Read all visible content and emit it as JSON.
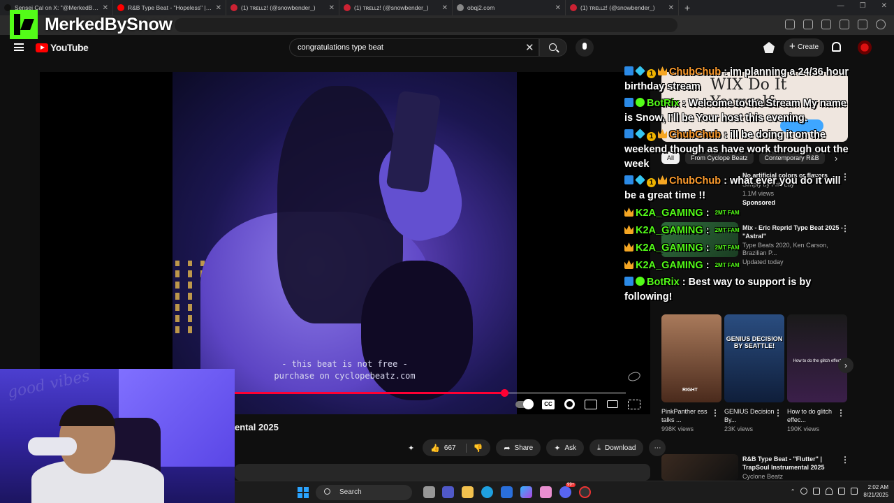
{
  "browser": {
    "tabs": [
      {
        "label": "Sensei Cal on X: \"@MerkedBySnow",
        "color": "#111111"
      },
      {
        "label": "R&B Type Beat - \"Hopeless\" | Trap",
        "color": "#ff0000"
      },
      {
        "label": "(1) ᴛʀᴇʟʟᴢ! (@snowbender_)",
        "color": "#cc2233"
      },
      {
        "label": "(1) ᴛʀᴇʟʟᴢ! (@snowbender_)",
        "color": "#cc2233"
      },
      {
        "label": "obqj2.com",
        "color": "#888888"
      },
      {
        "label": "(1) ᴛʀᴇʟʟᴢ! (@snowbender_)",
        "color": "#cc2233"
      }
    ],
    "new_tab": "+",
    "window_controls": [
      "—",
      "❐",
      "✕"
    ]
  },
  "overlay": {
    "brand_name": "MerkedBySnow"
  },
  "youtube": {
    "logo_text": "YouTube",
    "search_value": "congratulations type beat",
    "create_label": "Create"
  },
  "video": {
    "beat_text_line1": "- this beat is not free -",
    "beat_text_line2": "purchase on cyclopebeatz.com",
    "progress_fraction": 0.69,
    "title_fragment": "ental 2025",
    "actions": {
      "likes": "667",
      "share": "Share",
      "ask": "Ask",
      "download": "Download"
    }
  },
  "chat": [
    {
      "badges": [
        "blue",
        "cube",
        "one",
        "crown"
      ],
      "user": "ChubChub",
      "color": "orange",
      "text": "im planning a 24/36 hour birthday stream"
    },
    {
      "badges": [
        "blue",
        "check"
      ],
      "user": "BotRix",
      "color": "green",
      "text": "Welcome to the Stream My name is Snow, I'll be Your host this evening."
    },
    {
      "badges": [
        "blue",
        "cube",
        "one",
        "crown"
      ],
      "user": "ChubChub",
      "color": "orange",
      "text": "ill be doing it on the weekend though as have work through out the week"
    },
    {
      "badges": [
        "blue",
        "cube",
        "one",
        "crown"
      ],
      "user": "ChubChub",
      "color": "orange",
      "text": "what ever you do it will be a great time !!"
    },
    {
      "badges": [
        "crown"
      ],
      "user": "K2A_GAMING",
      "color": "green",
      "text": "2MT FAM"
    },
    {
      "badges": [
        "crown"
      ],
      "user": "K2A_GAMING",
      "color": "green",
      "text": "2MT FAM"
    },
    {
      "badges": [
        "crown"
      ],
      "user": "K2A_GAMING",
      "color": "green",
      "text": "2MT FAM"
    },
    {
      "badges": [
        "crown"
      ],
      "user": "K2A_GAMING",
      "color": "green",
      "text": "2MT FAM"
    },
    {
      "badges": [
        "blue",
        "check"
      ],
      "user": "BotRix",
      "color": "green",
      "text": "Best way to support is by following!"
    }
  ],
  "sidebar": {
    "ad_text": "WIX Do It Yourself.",
    "chips": [
      "All",
      "From Cyclope Beatz",
      "Contemporary R&B"
    ],
    "sponsored": {
      "title": "No artificial colors or flavors",
      "channel": "Simply by FritoLay",
      "views": "1.1M views",
      "label": "Sponsored"
    },
    "mix": {
      "title": "Mix - Eric Reprid Type Beat 2025 - \"Astral\"",
      "meta": "Type Beats 2020, Ken Carson, Brazilian P...",
      "updated": "Updated today"
    },
    "shorts": [
      {
        "title": "PinkPanther ess talks ...",
        "views": "998K views",
        "thumb_text": "RIGHT"
      },
      {
        "title": "GENIUS Decision By...",
        "views": "23K views",
        "thumb_text": "GENIUS DECISION BY SEATTLE!"
      },
      {
        "title": "How to do glitch effec...",
        "views": "190K views",
        "thumb_text": "How to do the glitch effect"
      }
    ],
    "bottom": {
      "title": "R&B Type Beat - \"Flutter\" | TrapSoul Instrumental 2025",
      "channel": "Cyclone Beatz"
    }
  },
  "taskbar": {
    "search_label": "Search",
    "time": "2:02 AM",
    "date": "8/21/2025",
    "notification_badge": "99+"
  }
}
